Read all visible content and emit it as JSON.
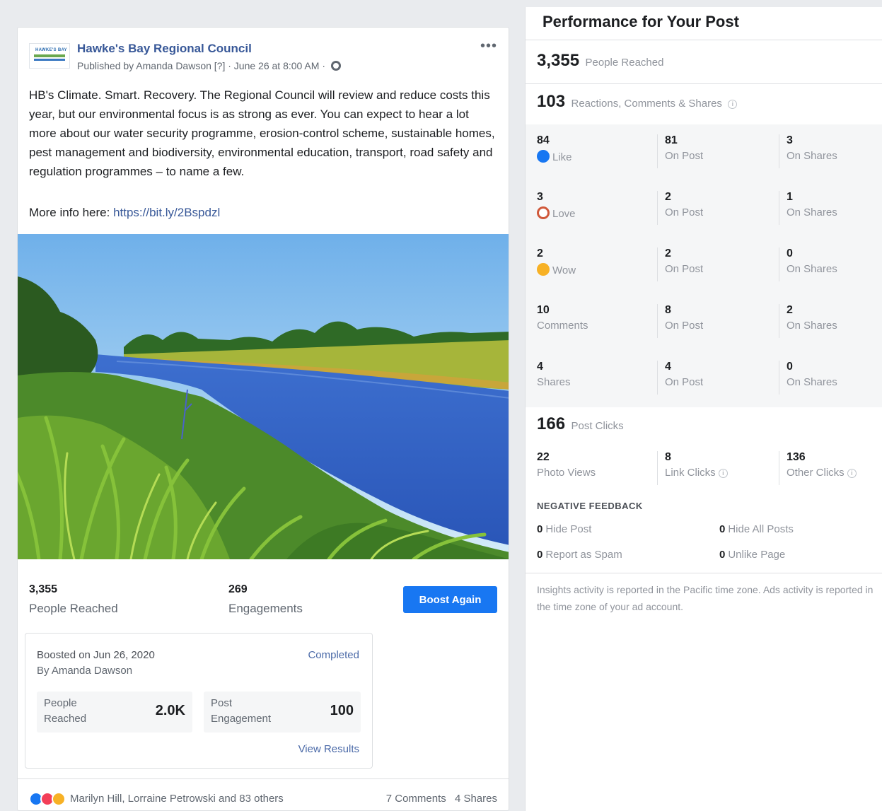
{
  "post": {
    "page_name": "Hawke's Bay Regional Council",
    "logo_text": "HAWKE'S BAY",
    "meta_prefix": "Published by Amanda Dawson [?] · June 26 at 8:00 AM ·",
    "more_label": "•••",
    "body": "HB's Climate. Smart. Recovery. The Regional Council will review and reduce costs this year, but our environmental focus is as strong as ever. You can expect to hear a lot more about our water security programme, erosion-control scheme, sustainable homes, pest management and biodiversity, environmental education, transport, road safety and regulation programmes – to name a few.",
    "link_prefix": "More info here: ",
    "link_text": "https://bit.ly/2Bspdzl"
  },
  "stats": {
    "reached_value": "3,355",
    "reached_label": "People Reached",
    "engagements_value": "269",
    "engagements_label": "Engagements",
    "boost_button": "Boost Again"
  },
  "boost": {
    "date": "Boosted on Jun 26, 2020",
    "by": "By Amanda Dawson",
    "status": "Completed",
    "people_reached_label_1": "People",
    "people_reached_label_2": "Reached",
    "people_reached_value": "2.0K",
    "post_engagement_label_1": "Post",
    "post_engagement_label_2": "Engagement",
    "post_engagement_value": "100",
    "view_results": "View Results"
  },
  "reactions": {
    "names": "Marilyn Hill, Lorraine Petrowski and 83 others",
    "comments": "7 Comments",
    "shares": "4 Shares"
  },
  "insights": {
    "title": "Performance for Your Post",
    "people_reached_value": "3,355",
    "people_reached_label": "People Reached",
    "rcs_value": "103",
    "rcs_label": "Reactions, Comments & Shares",
    "info_glyph": "i",
    "rows": [
      {
        "total": "84",
        "total_label": "Like",
        "icon": "like-icon",
        "on_post": "81",
        "on_post_label": "On Post",
        "on_shares": "3",
        "on_shares_label": "On Shares"
      },
      {
        "total": "3",
        "total_label": "Love",
        "icon": "love-icon",
        "on_post": "2",
        "on_post_label": "On Post",
        "on_shares": "1",
        "on_shares_label": "On Shares"
      },
      {
        "total": "2",
        "total_label": "Wow",
        "icon": "wow-icon",
        "on_post": "2",
        "on_post_label": "On Post",
        "on_shares": "0",
        "on_shares_label": "On Shares"
      },
      {
        "total": "10",
        "total_label": "Comments",
        "icon": "",
        "on_post": "8",
        "on_post_label": "On Post",
        "on_shares": "2",
        "on_shares_label": "On Shares"
      },
      {
        "total": "4",
        "total_label": "Shares",
        "icon": "",
        "on_post": "4",
        "on_post_label": "On Post",
        "on_shares": "0",
        "on_shares_label": "On Shares"
      }
    ],
    "post_clicks_value": "166",
    "post_clicks_label": "Post Clicks",
    "clicks": [
      {
        "value": "22",
        "label": "Photo Views"
      },
      {
        "value": "8",
        "label": "Link Clicks"
      },
      {
        "value": "136",
        "label": "Other Clicks"
      }
    ],
    "negative_title": "NEGATIVE FEEDBACK",
    "negative": [
      {
        "value": "0",
        "label": "Hide Post"
      },
      {
        "value": "0",
        "label": "Hide All Posts"
      },
      {
        "value": "0",
        "label": "Report as Spam"
      },
      {
        "value": "0",
        "label": "Unlike Page"
      }
    ],
    "footer": "Insights activity is reported in the Pacific time zone. Ads activity is reported in the time zone of your ad account."
  },
  "colors": {
    "accent": "#1877f2",
    "link": "#385898",
    "background": "#e9ebee"
  }
}
